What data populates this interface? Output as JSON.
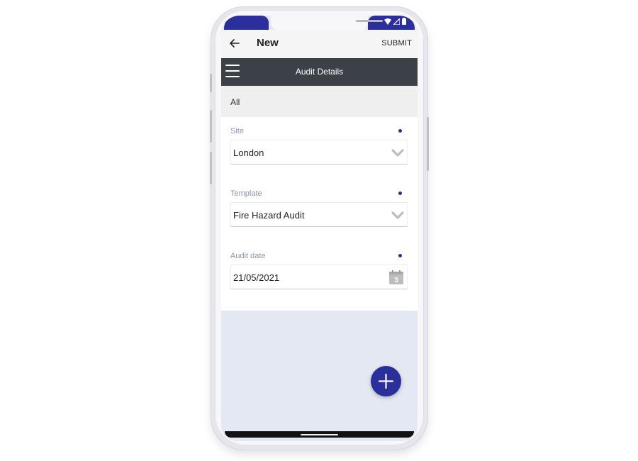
{
  "app_bar": {
    "title": "New",
    "submit_label": "SUBMIT",
    "back_icon": "arrow-left-icon"
  },
  "section": {
    "title": "Audit Details",
    "menu_icon": "hamburger-menu-icon"
  },
  "filter": {
    "label": "All"
  },
  "fields": {
    "site": {
      "label": "Site",
      "value": "London"
    },
    "template": {
      "label": "Template",
      "value": "Fire Hazard Audit"
    },
    "audit_date": {
      "label": "Audit date",
      "value": "21/05/2021",
      "calendar_day": "3"
    }
  },
  "colors": {
    "accent": "#2a2f9c",
    "section_bar": "#3c4148",
    "label": "#8a93a8",
    "background": "#e3e8f2"
  },
  "fab": {
    "icon": "plus-icon"
  }
}
